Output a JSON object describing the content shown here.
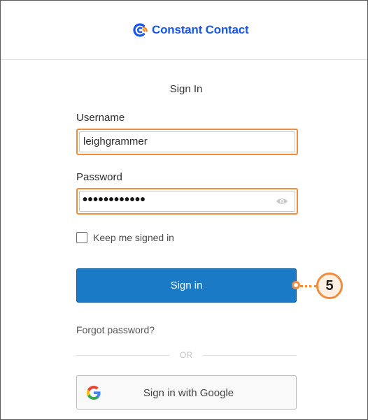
{
  "brand": {
    "name": "Constant Contact",
    "color": "#1856ed",
    "accent_color": "#f58220"
  },
  "form": {
    "title": "Sign In",
    "username_label": "Username",
    "username_value": "leighgrammer",
    "password_label": "Password",
    "password_masked": "••••••••••••",
    "show_password_icon": "eye-icon",
    "keep_signed_in_label": "Keep me signed in",
    "keep_signed_in_checked": false,
    "signin_label": "Sign in",
    "forgot_password_label": "Forgot password?",
    "divider_label": "OR",
    "google_label": "Sign in with Google",
    "google_icon": "google-icon"
  },
  "callout": {
    "number": "5",
    "color": "#f28b3c"
  },
  "colors": {
    "primary_button": "#1b7ac5",
    "highlight_border": "#f28b3c"
  }
}
